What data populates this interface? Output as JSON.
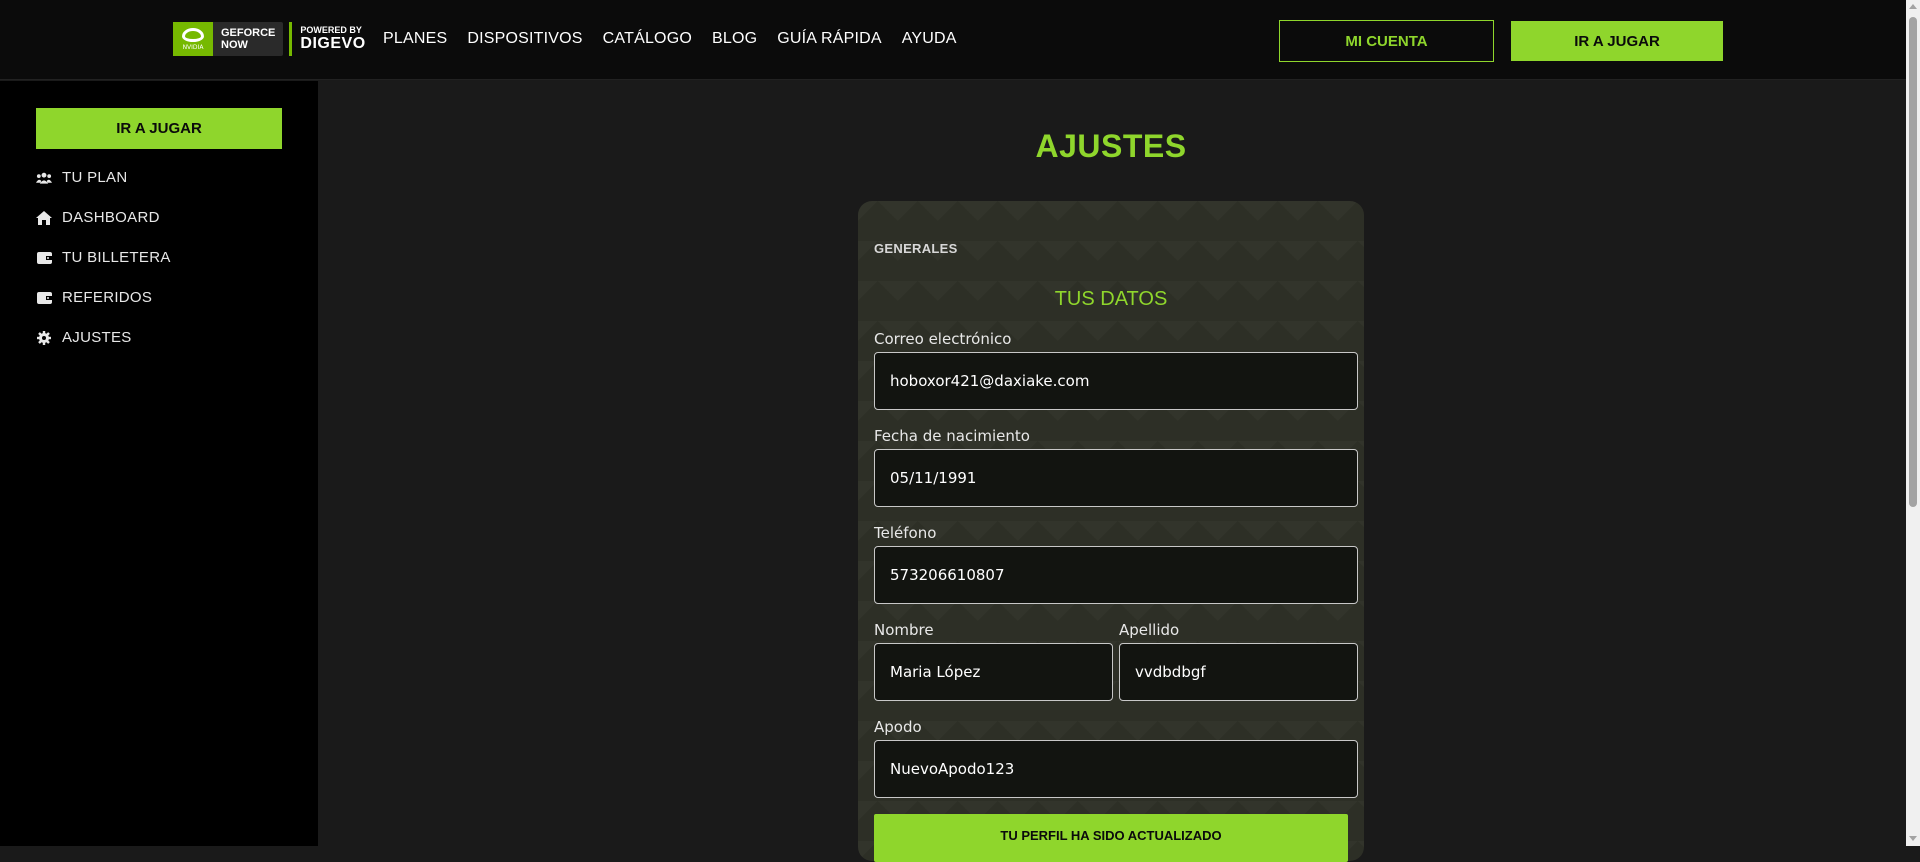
{
  "logo": {
    "geforce_line1": "GEFORCE",
    "geforce_line2": "NOW",
    "nvidia": "NVIDIA",
    "powered_by": "POWERED BY",
    "digevo": "DIGEVO"
  },
  "nav": {
    "items": [
      "PLANES",
      "DISPOSITIVOS",
      "CATÁLOGO",
      "BLOG",
      "GUÍA RÁPIDA",
      "AYUDA"
    ]
  },
  "header": {
    "mi_cuenta": "MI CUENTA",
    "ir_a_jugar": "IR A JUGAR"
  },
  "sidebar": {
    "ir_a_jugar": "IR A JUGAR",
    "items": [
      {
        "label": "TU PLAN",
        "icon": "users-icon"
      },
      {
        "label": "DASHBOARD",
        "icon": "home-icon"
      },
      {
        "label": "TU BILLETERA",
        "icon": "wallet-icon"
      },
      {
        "label": "REFERIDOS",
        "icon": "wallet-icon"
      },
      {
        "label": "AJUSTES",
        "icon": "gear-icon"
      }
    ]
  },
  "main": {
    "title": "AJUSTES",
    "section": "GENERALES",
    "subtitle": "TUS DATOS",
    "fields": {
      "email": {
        "label": "Correo electrónico",
        "value": "hoboxor421@daxiake.com"
      },
      "birthdate": {
        "label": "Fecha de nacimiento",
        "value": "05/11/1991"
      },
      "phone": {
        "label": "Teléfono",
        "value": "573206610807"
      },
      "first_name": {
        "label": "Nombre",
        "value": "Maria López"
      },
      "last_name": {
        "label": "Apellido",
        "value": "vvdbdbgf"
      },
      "nickname": {
        "label": "Apodo",
        "value": "NuevoApodo123"
      }
    },
    "status_button": "TU PERFIL HA SIDO ACTUALIZADO"
  },
  "colors": {
    "accent": "#8fd62c",
    "nav_bg": "#0b0b0b",
    "sidebar_bg": "#000000",
    "page_bg": "#1a1a1a",
    "card_bg": "#2d2f26"
  }
}
